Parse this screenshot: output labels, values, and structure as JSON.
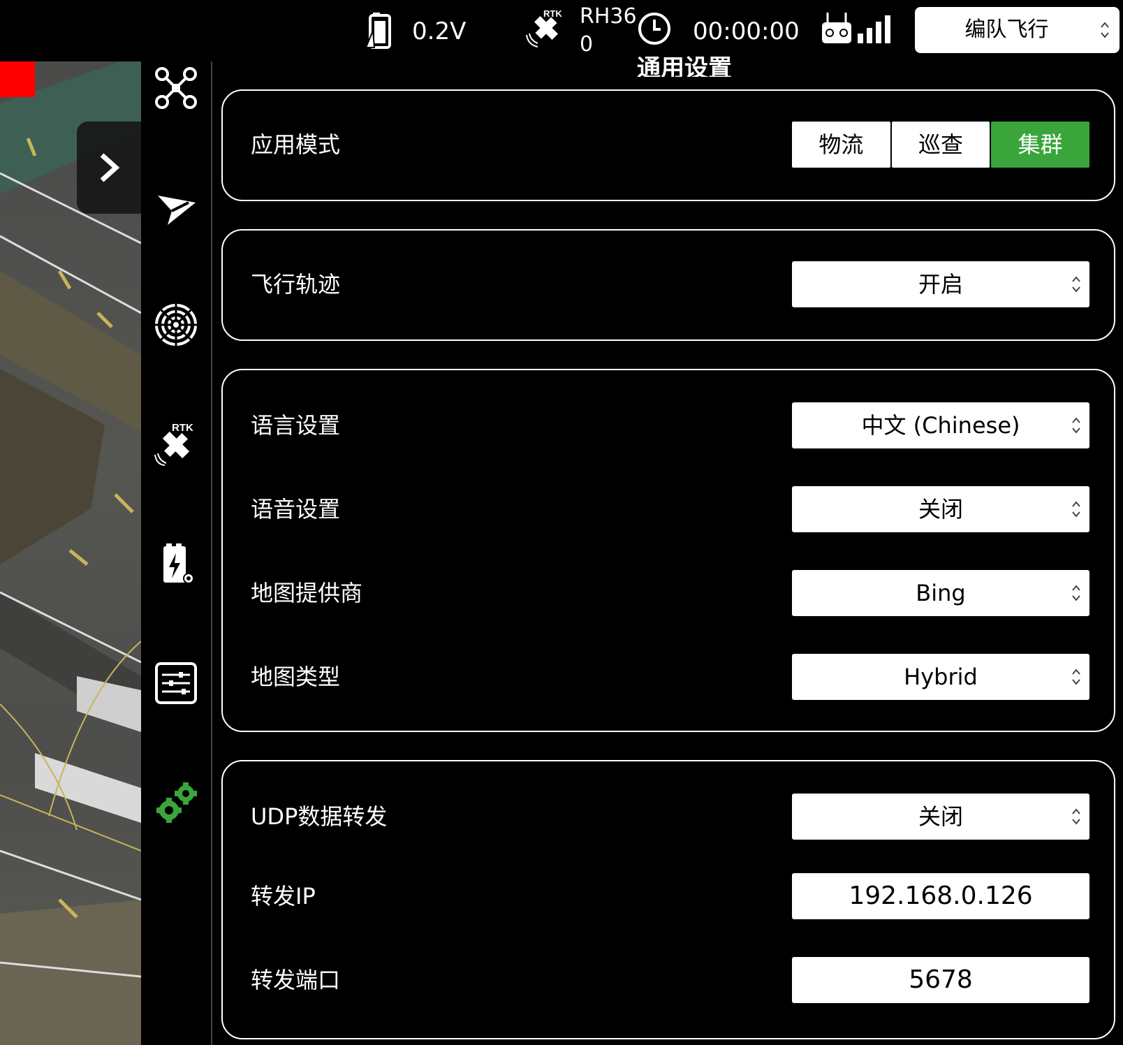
{
  "status_bar": {
    "battery_voltage": "0.2V",
    "rtk_badge": "RTK",
    "rtk_status_line1": "RH36",
    "rtk_status_line2": "0",
    "flight_timer": "00:00:00",
    "mode_select": {
      "selected": "编队飞行"
    }
  },
  "nav_rail": {
    "items": [
      {
        "icon": "drone-icon"
      },
      {
        "icon": "send-icon"
      },
      {
        "icon": "radar-icon"
      },
      {
        "icon": "rtk-icon",
        "badge": "RTK"
      },
      {
        "icon": "battery-settings-icon"
      },
      {
        "icon": "sliders-icon"
      },
      {
        "icon": "gears-icon",
        "active": true
      }
    ]
  },
  "panel": {
    "title": "通用设置",
    "application_mode": {
      "label": "应用模式",
      "options": [
        "物流",
        "巡查",
        "集群"
      ],
      "selected": "集群"
    },
    "flight_track": {
      "label": "飞行轨迹",
      "value": "开启"
    },
    "language": {
      "label": "语言设置",
      "value": "中文 (Chinese)"
    },
    "voice": {
      "label": "语音设置",
      "value": "关闭"
    },
    "map_provider": {
      "label": "地图提供商",
      "value": "Bing"
    },
    "map_type": {
      "label": "地图类型",
      "value": "Hybrid"
    },
    "udp_forward": {
      "label": "UDP数据转发",
      "value": "关闭"
    },
    "forward_ip": {
      "label": "转发IP",
      "value": "192.168.0.126"
    },
    "forward_port": {
      "label": "转发端口",
      "value": "5678"
    }
  },
  "colors": {
    "accent_green": "#3aa53b",
    "alert_red": "#ff0000"
  }
}
